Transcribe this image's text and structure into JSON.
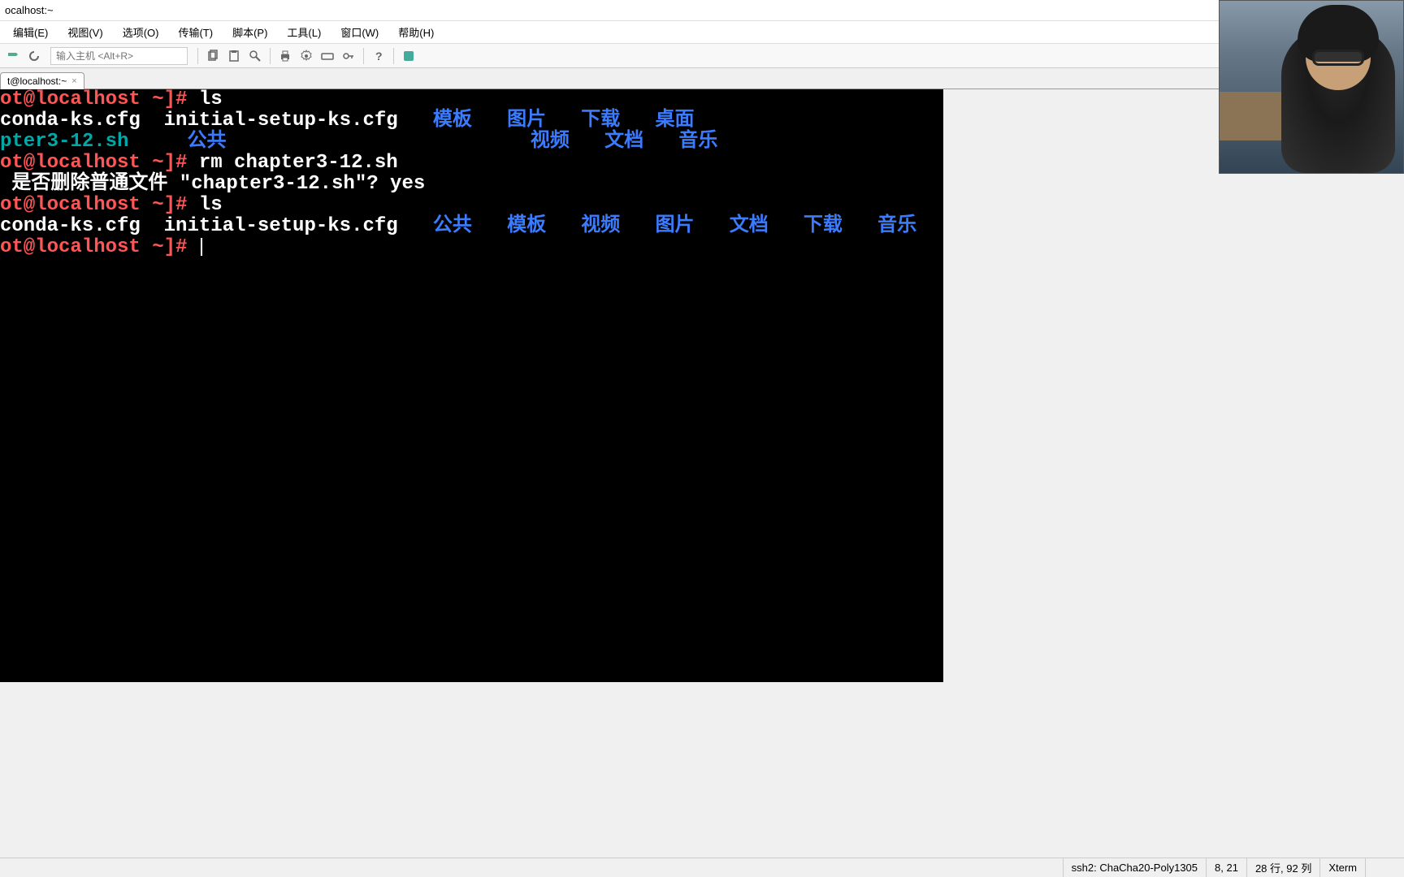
{
  "window": {
    "title": "ocalhost:~"
  },
  "menus": {
    "edit": "编辑(E)",
    "view": "视图(V)",
    "options": "选项(O)",
    "transfer": "传输(T)",
    "scripts": "脚本(P)",
    "tools": "工具(L)",
    "window": "窗口(W)",
    "help": "帮助(H)"
  },
  "toolbar": {
    "host_placeholder": "输入主机 <Alt+R>"
  },
  "tab": {
    "label": "t@localhost:~",
    "close": "×"
  },
  "terminal": {
    "line1_prompt": "ot@localhost ~]# ",
    "line1_cmd": "ls",
    "ls1_files": "conda-ks.cfg  initial-setup-ks.cfg",
    "ls1_dirs1": "   模板   图片   下载   桌面",
    "ls1_script": "pter3-12.sh",
    "ls1_dirs2": "     公共",
    "ls1_dirs3": "                          视频   文档   音乐",
    "line2_prompt": "ot@localhost ~]# ",
    "line2_cmd": "rm chapter3-12.sh",
    "rm_confirm": " 是否删除普通文件 \"chapter3-12.sh\"? yes",
    "line3_prompt": "ot@localhost ~]# ",
    "line3_cmd": "ls",
    "ls2_files": "conda-ks.cfg  initial-setup-ks.cfg",
    "ls2_dirs": "   公共   模板   视频   图片   文档   下载   音乐   桌面",
    "line4_prompt": "ot@localhost ~]# "
  },
  "status": {
    "conn": "ssh2: ChaCha20-Poly1305",
    "pos": "8, 21",
    "size": "28 行, 92 列",
    "term": "Xterm"
  }
}
